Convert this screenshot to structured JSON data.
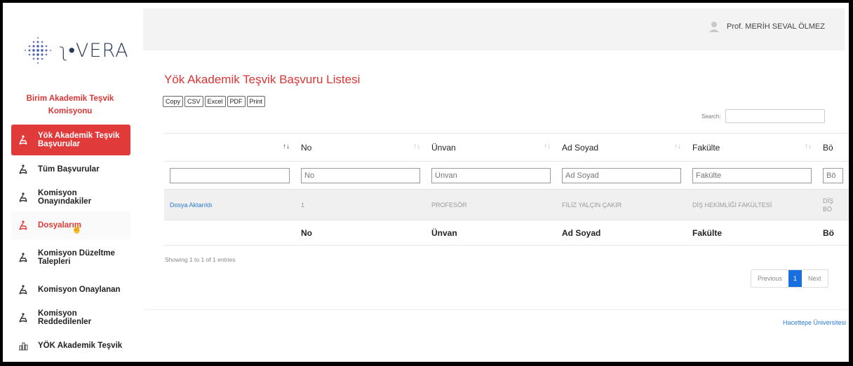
{
  "app": {
    "logo_text": "ʅ•VERA",
    "org_title_line1": "Birim Akademik Teşvik",
    "org_title_line2": "Komisyonu"
  },
  "user": {
    "name": "Prof. MERİH SEVAL ÖLMEZ"
  },
  "sidebar": {
    "items": [
      {
        "label": "Yök Akademik Teşvik",
        "label2": "Başvurular",
        "icon": "person-icon",
        "state": "active"
      },
      {
        "label": "Tüm Başvurular",
        "icon": "person-icon"
      },
      {
        "label": "Komisyon Onayındakiler",
        "icon": "person-icon"
      },
      {
        "label": "Dosyalarım",
        "icon": "person-icon",
        "state": "hover"
      },
      {
        "label": "Komisyon Düzeltme",
        "label2": "Talepleri",
        "icon": "person-icon"
      },
      {
        "label": "Komisyon Onaylanan",
        "icon": "person-icon"
      },
      {
        "label": "Komisyon Reddedilenler",
        "icon": "person-icon"
      },
      {
        "label": "YÖK Akademik Teşvik",
        "icon": "chart-icon"
      }
    ]
  },
  "main": {
    "title": "Yök Akademik Teşvik Başvuru Listesi",
    "export_buttons": [
      "Copy",
      "CSV",
      "Excel",
      "PDF",
      "Print"
    ],
    "search_label": "Search:",
    "table": {
      "headers": [
        "",
        "No",
        "Ünvan",
        "Ad Soyad",
        "Fakülte",
        "Bö"
      ],
      "filter_placeholders": [
        "",
        "No",
        "Ünvan",
        "Ad Soyad",
        "Fakülte",
        "Bö"
      ],
      "rows": [
        {
          "status": "Dosya Aktarıldı",
          "no": "1",
          "unvan": "PROFESÖR",
          "ad_soyad": "FİLİZ YALÇIN ÇAKIR",
          "fakulte": "DİŞ HEKİMLİĞİ FAKÜLTESİ",
          "bolum_1": "DİŞ",
          "bolum_2": "BÖ"
        }
      ],
      "footers": [
        "",
        "No",
        "Ünvan",
        "Ad Soyad",
        "Fakülte",
        "Bö"
      ]
    },
    "info": "Showing 1 to 1 of 1 entries",
    "pager": {
      "previous": "Previous",
      "current": "1",
      "next": "Next"
    }
  },
  "footer": {
    "text": "Hacettepe Üniversitesi"
  },
  "colors": {
    "accent": "#e03a3a",
    "link": "#2a7bd3",
    "pager_active": "#1a6fe0"
  }
}
